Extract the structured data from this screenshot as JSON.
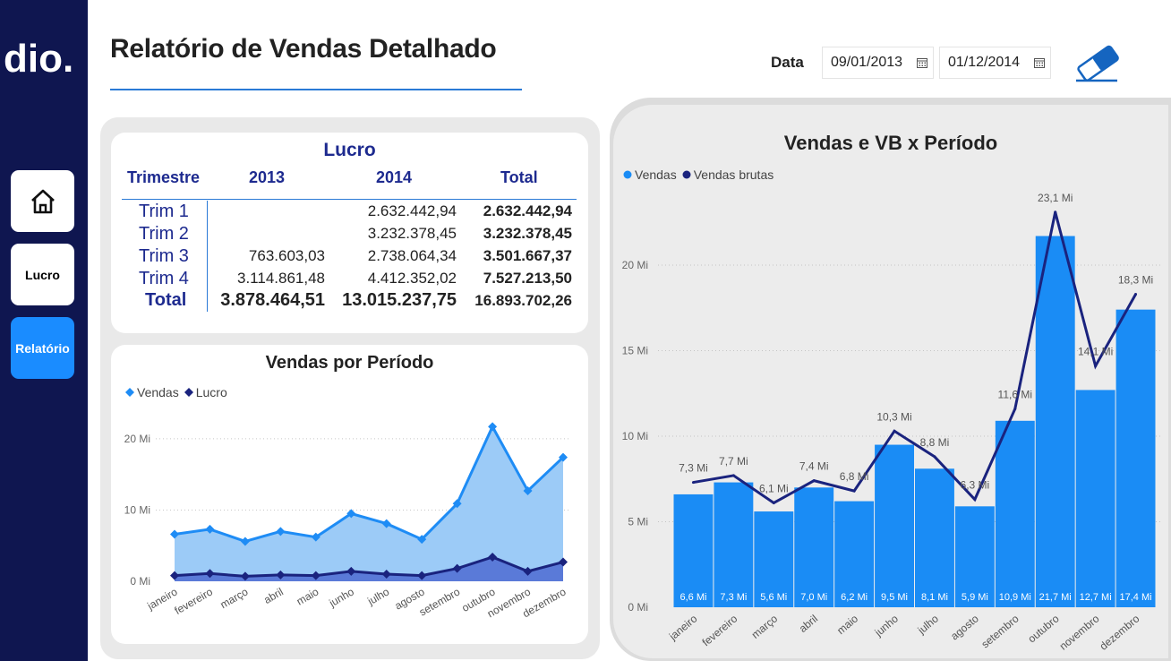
{
  "sidebar": {
    "logo_text": "dio.",
    "items": [
      {
        "label": ""
      },
      {
        "label": "Lucro"
      },
      {
        "label": "Relatório"
      }
    ]
  },
  "header": {
    "title": "Relatório de Vendas Detalhado",
    "date_label": "Data",
    "date_start": "09/01/2013",
    "date_end": "01/12/2014"
  },
  "profit_table": {
    "title": "Lucro",
    "headers": [
      "Trimestre",
      "2013",
      "2014",
      "Total"
    ],
    "rows": [
      {
        "label": "Trim 1",
        "y2013": "",
        "y2014": "2.632.442,94",
        "total": "2.632.442,94"
      },
      {
        "label": "Trim 2",
        "y2013": "",
        "y2014": "3.232.378,45",
        "total": "3.232.378,45"
      },
      {
        "label": "Trim 3",
        "y2013": "763.603,03",
        "y2014": "2.738.064,34",
        "total": "3.501.667,37"
      },
      {
        "label": "Trim 4",
        "y2013": "3.114.861,48",
        "y2014": "4.412.352,02",
        "total": "7.527.213,50"
      }
    ],
    "total_row": {
      "label": "Total",
      "y2013": "3.878.464,51",
      "y2014": "13.015.237,75",
      "total": "16.893.702,26"
    }
  },
  "chart_data": [
    {
      "type": "area",
      "title": "Vendas por Período",
      "categories": [
        "janeiro",
        "fevereiro",
        "março",
        "abril",
        "maio",
        "junho",
        "julho",
        "agosto",
        "setembro",
        "outubro",
        "novembro",
        "dezembro"
      ],
      "series": [
        {
          "name": "Vendas",
          "values": [
            6.6,
            7.3,
            5.6,
            7.0,
            6.2,
            9.5,
            8.1,
            5.9,
            10.9,
            21.7,
            12.7,
            17.4
          ],
          "color": "#1e8cf5"
        },
        {
          "name": "Lucro",
          "values": [
            0.8,
            1.1,
            0.7,
            0.9,
            0.8,
            1.4,
            1.0,
            0.8,
            1.8,
            3.4,
            1.4,
            2.7
          ],
          "color": "#1a237e"
        }
      ],
      "yticks": [
        "0 Mi",
        "10 Mi",
        "20 Mi"
      ],
      "ylim": [
        0,
        22
      ],
      "legend_position": "top-left",
      "grid": true
    },
    {
      "type": "bar",
      "title": "Vendas e VB x Período",
      "categories": [
        "janeiro",
        "fevereiro",
        "março",
        "abril",
        "maio",
        "junho",
        "julho",
        "agosto",
        "setembro",
        "outubro",
        "novembro",
        "dezembro"
      ],
      "series": [
        {
          "name": "Vendas",
          "values": [
            6.6,
            7.3,
            5.6,
            7.0,
            6.2,
            9.5,
            8.1,
            5.9,
            10.9,
            21.7,
            12.7,
            17.4
          ],
          "labels": [
            "6,6 Mi",
            "7,3 Mi",
            "5,6 Mi",
            "7,0 Mi",
            "6,2 Mi",
            "9,5 Mi",
            "8,1 Mi",
            "5,9 Mi",
            "10,9 Mi",
            "21,7 Mi",
            "12,7 Mi",
            "17,4 Mi"
          ],
          "color": "#1a8cf5"
        },
        {
          "name": "Vendas brutas",
          "type": "line",
          "values": [
            7.3,
            7.7,
            6.1,
            7.4,
            6.8,
            10.3,
            8.8,
            6.3,
            11.6,
            23.1,
            14.1,
            18.3
          ],
          "labels": [
            "7,3 Mi",
            "7,7 Mi",
            "6,1 Mi",
            "7,4 Mi",
            "6,8 Mi",
            "10,3 Mi",
            "8,8 Mi",
            "6,3 Mi",
            "11,6 Mi",
            "23,1 Mi",
            "14,1 Mi",
            "18,3 Mi"
          ],
          "color": "#1a237e"
        }
      ],
      "yticks": [
        "0 Mi",
        "5 Mi",
        "10 Mi",
        "15 Mi",
        "20 Mi"
      ],
      "ylim": [
        0,
        25
      ],
      "legend_position": "top-left",
      "grid": true
    }
  ]
}
